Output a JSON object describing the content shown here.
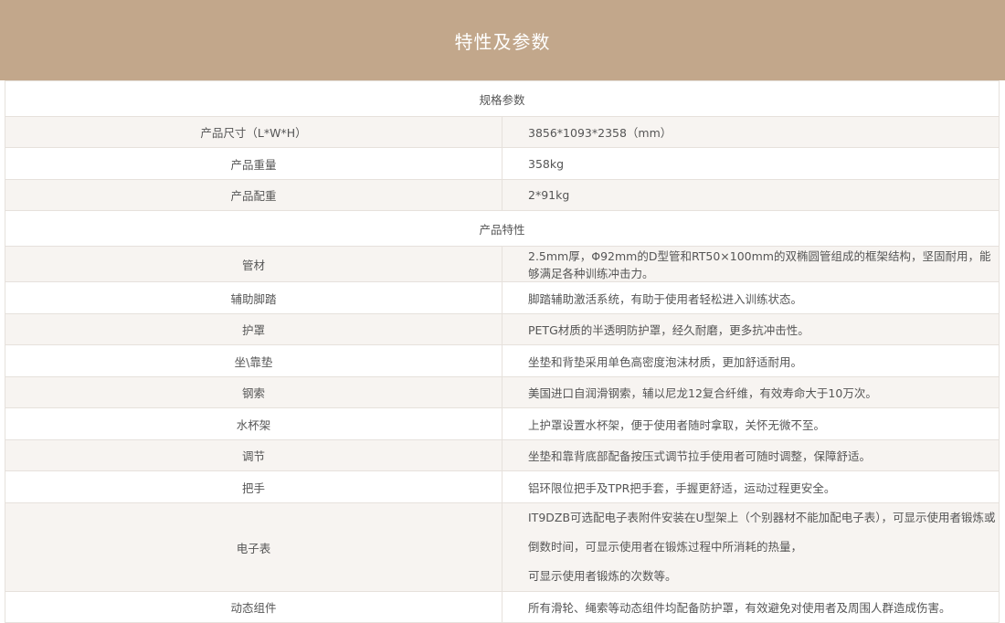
{
  "banner": {
    "title": "特性及参数"
  },
  "sections": {
    "specs_title": "规格参数",
    "features_title": "产品特性"
  },
  "specs": [
    {
      "label": "产品尺寸（L*W*H）",
      "value": "3856*1093*2358（mm）"
    },
    {
      "label": "产品重量",
      "value": "358kg"
    },
    {
      "label": "产品配重",
      "value": "2*91kg"
    }
  ],
  "features": [
    {
      "label": "管材",
      "value": "2.5mm厚，Φ92mm的D型管和RT50×100mm的双椭圆管组成的框架结构，坚固耐用，能够满足各种训练冲击力。"
    },
    {
      "label": "辅助脚踏",
      "value": "脚踏辅助激活系统，有助于使用者轻松进入训练状态。"
    },
    {
      "label": "护罩",
      "value": "PETG材质的半透明防护罩，经久耐磨，更多抗冲击性。"
    },
    {
      "label": "坐\\靠垫",
      "value": "坐垫和背垫采用单色高密度泡沫材质，更加舒适耐用。"
    },
    {
      "label": "钢索",
      "value": "美国进口自润滑钢索，辅以尼龙12复合纤维，有效寿命大于10万次。"
    },
    {
      "label": "水杯架",
      "value": "上护罩设置水杯架，便于使用者随时拿取，关怀无微不至。"
    },
    {
      "label": "调节",
      "value": "坐垫和靠背底部配备按压式调节拉手使用者可随时调整，保障舒适。"
    },
    {
      "label": "把手",
      "value": "铝环限位把手及TPR把手套，手握更舒适，运动过程更安全。"
    },
    {
      "label": "电子表",
      "value_line1": "IT9DZB可选配电子表附件安装在U型架上（个别器材不能加配电子表），可显示使用者锻炼或倒数时间，可显示使用者在锻炼过程中所消耗的热量，",
      "value_line2": "可显示使用者锻炼的次数等。"
    },
    {
      "label": "动态组件",
      "value": "所有滑轮、绳索等动态组件均配备防护罩，有效避免对使用者及周围人群造成伤害。"
    }
  ]
}
